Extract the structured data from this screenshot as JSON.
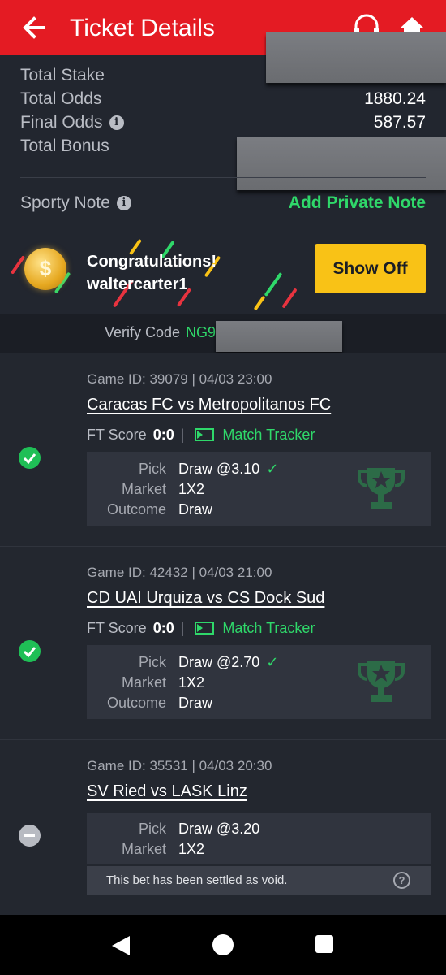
{
  "header": {
    "title": "Ticket Details",
    "icons": [
      "back-arrow-icon",
      "headset-icon",
      "home-icon"
    ]
  },
  "summary": {
    "total_stake_label": "Total Stake",
    "total_odds_label": "Total Odds",
    "total_odds_value": "1880.24",
    "final_odds_label": "Final Odds",
    "final_odds_value": "587.57",
    "total_bonus_label": "Total Bonus",
    "sporty_note_label": "Sporty Note",
    "add_note_label": "Add Private Note"
  },
  "banner": {
    "congrats": "Congratulations!",
    "username": "waltercarter1",
    "show_off_label": "Show Off"
  },
  "verify": {
    "label": "Verify Code",
    "code": "NG9"
  },
  "bets": [
    {
      "game_id": "Game ID: 39079 | 04/03 23:00",
      "match": "Caracas FC vs Metropolitanos FC",
      "ft_label": "FT Score",
      "ft_score": "0:0",
      "tracker": "Match Tracker",
      "pick_label": "Pick",
      "pick": "Draw @3.10",
      "market_label": "Market",
      "market": "1X2",
      "outcome_label": "Outcome",
      "outcome": "Draw",
      "status": "won"
    },
    {
      "game_id": "Game ID: 42432 | 04/03 21:00",
      "match": "CD UAI Urquiza vs CS Dock Sud",
      "ft_label": "FT Score",
      "ft_score": "0:0",
      "tracker": "Match Tracker",
      "pick_label": "Pick",
      "pick": "Draw @2.70",
      "market_label": "Market",
      "market": "1X2",
      "outcome_label": "Outcome",
      "outcome": "Draw",
      "status": "won"
    },
    {
      "game_id": "Game ID: 35531 | 04/03 20:30",
      "match": "SV Ried vs LASK Linz",
      "pick_label": "Pick",
      "pick": "Draw @3.20",
      "market_label": "Market",
      "market": "1X2",
      "void_note": "This bet has been settled as void.",
      "status": "void"
    }
  ],
  "colors": {
    "brand_red": "#e41b23",
    "accent_green": "#2fd86a",
    "button_yellow": "#f9c216"
  }
}
